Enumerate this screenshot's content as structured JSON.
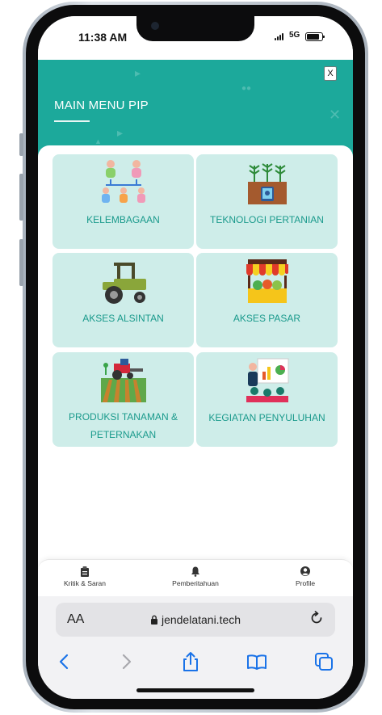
{
  "status_bar": {
    "time": "11:38 AM",
    "network": "5G"
  },
  "header": {
    "title": "MAIN MENU PIP",
    "close_label": "X"
  },
  "menu": [
    {
      "label": "KELEMBAGAAN",
      "icon": "people-organization-icon"
    },
    {
      "label": "TEKNOLOGI PERTANIAN",
      "icon": "plant-tablet-icon"
    },
    {
      "label": "AKSES ALSINTAN",
      "icon": "tractor-icon"
    },
    {
      "label": "AKSES PASAR",
      "icon": "market-stall-icon"
    },
    {
      "label_line1": "PRODUKSI TANAMAN &",
      "label_line2": "PETERNAKAN",
      "icon": "tractor-field-icon"
    },
    {
      "label": "KEGIATAN PENYULUHAN",
      "icon": "presentation-board-icon"
    }
  ],
  "bottom_nav": [
    {
      "label": "Kritik & Saran",
      "icon": "clipboard-icon"
    },
    {
      "label": "Pemberitahuan",
      "icon": "bell-icon"
    },
    {
      "label": "Profile",
      "icon": "user-circle-icon"
    }
  ],
  "browser": {
    "aa_label": "AA",
    "url": "jendelatani.tech"
  },
  "colors": {
    "accent": "#1ca99b",
    "card_bg": "#ceede9",
    "card_text": "#1a9a8c",
    "ios_blue": "#1a73e8"
  }
}
